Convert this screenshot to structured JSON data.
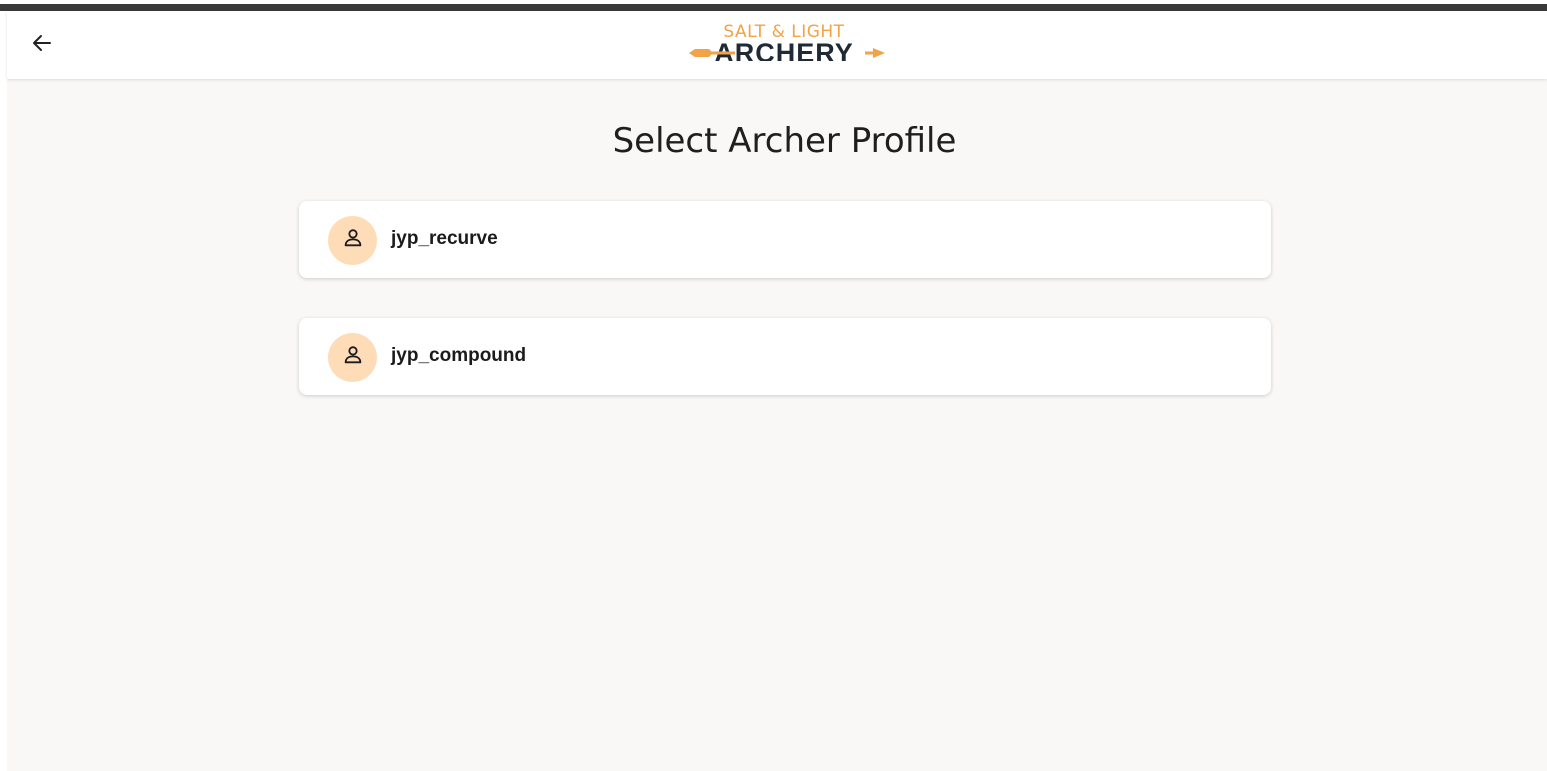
{
  "header": {
    "back_icon": "arrow-left-icon",
    "logo": {
      "top_text": "SALT & LIGHT",
      "main_text": "ARCHERY",
      "accent_color": "#f2a247",
      "dark_color": "#1f2a36"
    }
  },
  "main": {
    "title": "Select Archer Profile",
    "profiles": [
      {
        "name": "jyp_recurve",
        "icon": "person-icon"
      },
      {
        "name": "jyp_compound",
        "icon": "person-icon"
      }
    ]
  },
  "colors": {
    "background": "#f9f8f7",
    "avatar_bg": "#ffdcb8",
    "top_bar": "#3a3a3a"
  }
}
